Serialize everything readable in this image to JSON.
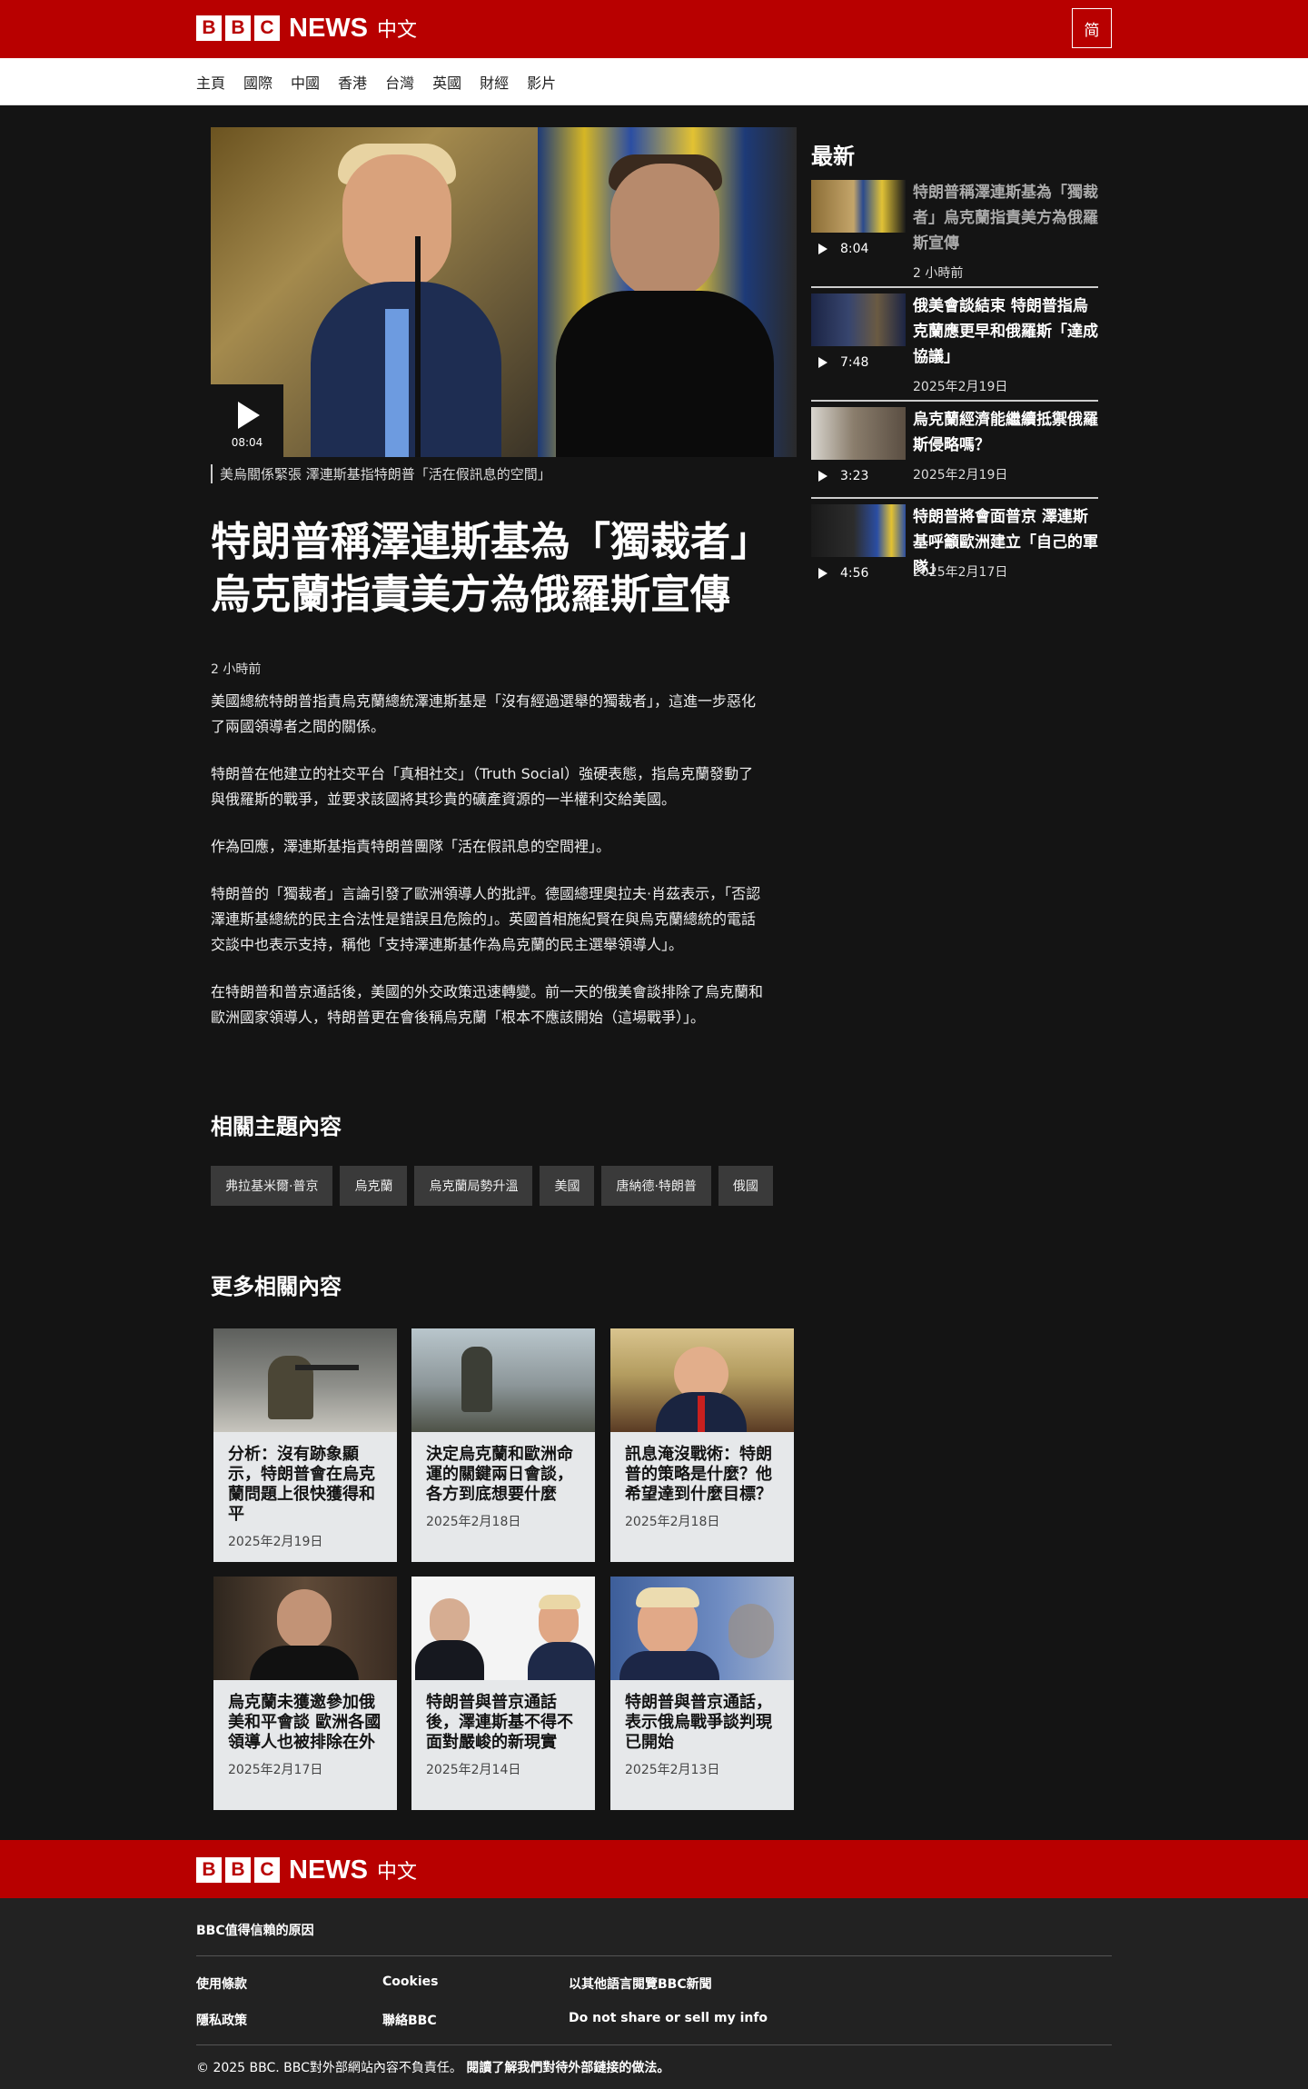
{
  "brand": {
    "letters": [
      "B",
      "B",
      "C"
    ],
    "news": "NEWS",
    "lang": "中文"
  },
  "header": {
    "simplified_button": "简"
  },
  "nav": {
    "items": [
      "主頁",
      "國際",
      "中國",
      "香港",
      "台灣",
      "英國",
      "財經",
      "影片"
    ]
  },
  "hero": {
    "duration": "08:04",
    "caption": "美烏關係緊張 澤連斯基指特朗普「活在假訊息的空間」"
  },
  "article": {
    "headline": "特朗普稱澤連斯基為「獨裁者」 烏克蘭指責美方為俄羅斯宣傳",
    "timestamp": "2 小時前",
    "paragraphs": [
      "美國總統特朗普指責烏克蘭總統澤連斯基是「沒有經過選舉的獨裁者」，這進一步惡化了兩國領導者之間的關係。",
      "特朗普在他建立的社交平台「真相社交」（Truth Social）強硬表態，指烏克蘭發動了與俄羅斯的戰爭，並要求該國將其珍貴的礦產資源的一半權利交給美國。",
      "作為回應，澤連斯基指責特朗普團隊「活在假訊息的空間裡」。",
      "特朗普的「獨裁者」言論引發了歐洲領導人的批評。德國總理奧拉夫·肖茲表示，「否認澤連斯基總統的民主合法性是錯誤且危險的」。英國首相施紀賢在與烏克蘭總統的電話交談中也表示支持，稱他「支持澤連斯基作為烏克蘭的民主選舉領導人」。",
      "在特朗普和普京通話後，美國的外交政策迅速轉變。前一天的俄美會談排除了烏克蘭和歐洲國家領導人，特朗普更在會後稱烏克蘭「根本不應該開始（這場戰爭）」。"
    ]
  },
  "topics": {
    "title": "相關主題內容",
    "tags": [
      "弗拉基米爾·普京",
      "烏克蘭",
      "烏克蘭局勢升溫",
      "美國",
      "唐納德·特朗普",
      "俄國"
    ]
  },
  "more": {
    "title": "更多相關內容",
    "cards": [
      {
        "title": "分析：沒有跡象顯示，特朗普會在烏克蘭問題上很快獲得和平",
        "date": "2025年2月19日"
      },
      {
        "title": "決定烏克蘭和歐洲命運的關鍵兩日會談，各方到底想要什麼",
        "date": "2025年2月18日"
      },
      {
        "title": "訊息淹沒戰術：特朗普的策略是什麼？他希望達到什麼目標？",
        "date": "2025年2月18日"
      },
      {
        "title": "烏克蘭未獲邀參加俄美和平會談 歐洲各國領導人也被排除在外",
        "date": "2025年2月17日"
      },
      {
        "title": "特朗普與普京通話後，澤連斯基不得不面對嚴峻的新現實",
        "date": "2025年2月14日"
      },
      {
        "title": "特朗普與普京通話，表示俄烏戰爭談判現已開始",
        "date": "2025年2月13日"
      }
    ]
  },
  "sidebar": {
    "title": "最新",
    "items": [
      {
        "title": "特朗普稱澤連斯基為「獨裁者」烏克蘭指責美方為俄羅斯宣傳",
        "duration": "8:04",
        "date": "2 小時前"
      },
      {
        "title": "俄美會談結束 特朗普指烏克蘭應更早和俄羅斯「達成協議」",
        "duration": "7:48",
        "date": "2025年2月19日"
      },
      {
        "title": "烏克蘭經濟能繼續抵禦俄羅斯侵略嗎？",
        "duration": "3:23",
        "date": "2025年2月19日"
      },
      {
        "title": "特朗普將會面普京 澤連斯基呼籲歐洲建立「自己的軍隊」",
        "duration": "4:56",
        "date": "2025年2月17日"
      }
    ]
  },
  "footer": {
    "trust": "BBC值得信賴的原因",
    "links": [
      "使用條款",
      "Cookies",
      "以其他語言閱覽BBC新聞",
      "隱私政策",
      "聯絡BBC",
      "Do not share or sell my info"
    ],
    "copyright": "© 2025 BBC. BBC對外部網站內容不負責任。",
    "external_link": "閱讀了解我們對待外部鏈接的做法。"
  },
  "colors": {
    "brand_red": "#b80000",
    "page_bg": "#141414",
    "card_bg": "#e6e8ea"
  }
}
